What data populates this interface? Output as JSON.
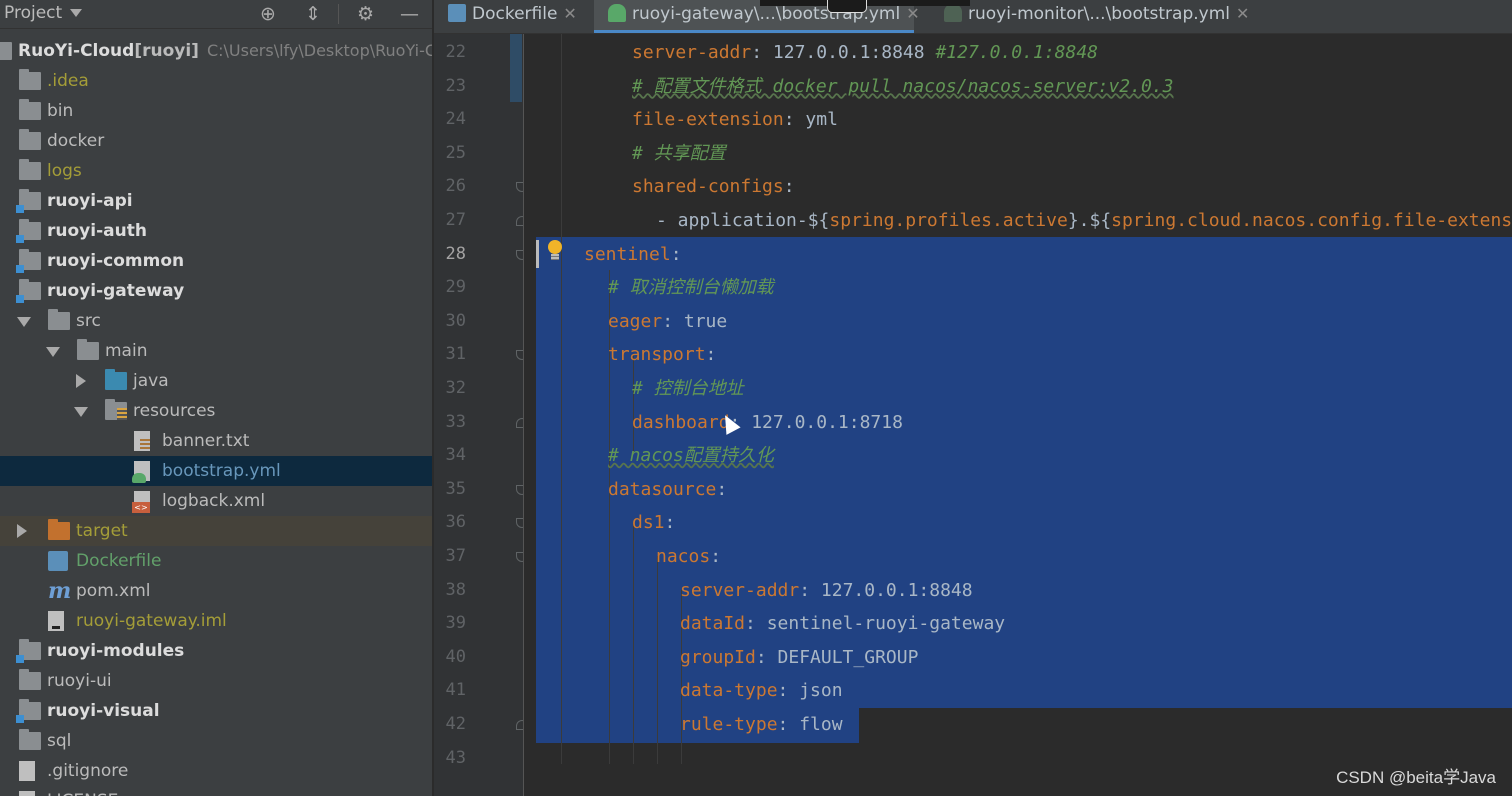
{
  "project_panel": {
    "title": "Project",
    "tree": [
      {
        "label": "RuoYi-Cloud",
        "tag": "[ruoyi]",
        "hint": "C:\\Users\\lfy\\Desktop\\RuoYi-C",
        "style": "bold",
        "icon": "module-icon"
      },
      {
        "label": ".idea",
        "style": "olive",
        "icon": "folder-icon"
      },
      {
        "label": "bin",
        "style": "normal",
        "icon": "folder-icon"
      },
      {
        "label": "docker",
        "style": "normal",
        "icon": "folder-icon"
      },
      {
        "label": "logs",
        "style": "olive",
        "icon": "folder-icon"
      },
      {
        "label": "ruoyi-api",
        "style": "bold",
        "icon": "module-icon"
      },
      {
        "label": "ruoyi-auth",
        "style": "bold",
        "icon": "module-icon"
      },
      {
        "label": "ruoyi-common",
        "style": "bold",
        "icon": "module-icon"
      },
      {
        "label": "ruoyi-gateway",
        "style": "bold",
        "icon": "module-icon"
      },
      {
        "label": "src",
        "style": "normal",
        "icon": "folder-icon"
      },
      {
        "label": "main",
        "style": "normal",
        "icon": "folder-icon"
      },
      {
        "label": "java",
        "style": "normal",
        "icon": "source-folder-icon"
      },
      {
        "label": "resources",
        "style": "normal",
        "icon": "resources-folder-icon"
      },
      {
        "label": "banner.txt",
        "style": "normal",
        "icon": "text-file-icon"
      },
      {
        "label": "bootstrap.yml",
        "style": "blue",
        "icon": "yaml-file-icon",
        "selected": true
      },
      {
        "label": "logback.xml",
        "style": "normal",
        "icon": "xml-file-icon"
      },
      {
        "label": "target",
        "style": "olive",
        "icon": "excluded-folder-icon"
      },
      {
        "label": "Dockerfile",
        "style": "green",
        "icon": "docker-file-icon"
      },
      {
        "label": "pom.xml",
        "style": "normal",
        "icon": "maven-icon"
      },
      {
        "label": "ruoyi-gateway.iml",
        "style": "olive",
        "icon": "iml-file-icon"
      },
      {
        "label": "ruoyi-modules",
        "style": "bold",
        "icon": "module-icon"
      },
      {
        "label": "ruoyi-ui",
        "style": "normal",
        "icon": "folder-icon"
      },
      {
        "label": "ruoyi-visual",
        "style": "bold",
        "icon": "module-icon"
      },
      {
        "label": "sql",
        "style": "normal",
        "icon": "folder-icon"
      },
      {
        "label": ".gitignore",
        "style": "normal",
        "icon": "gitignore-file-icon"
      },
      {
        "label": "LICENSE",
        "style": "normal",
        "icon": "text-file-icon"
      }
    ]
  },
  "tabs": [
    {
      "label": "Dockerfile",
      "icon": "docker-icon",
      "active": false
    },
    {
      "label": "ruoyi-gateway\\...\\bootstrap.yml",
      "icon": "yaml-icon",
      "active": true
    },
    {
      "label": "ruoyi-monitor\\...\\bootstrap.yml",
      "icon": "yaml-icon",
      "active": false
    }
  ],
  "editor": {
    "current_line": 28,
    "lines": [
      {
        "n": 22,
        "parts": [
          [
            "k",
            "server-addr"
          ],
          [
            "v",
            ": 127.0.0.1:8848 "
          ],
          [
            "c",
            "#127.0.0.1:8848"
          ]
        ]
      },
      {
        "n": 23,
        "parts": [
          [
            "c",
            "# 配置文件格式 docker pull nacos/nacos-server:v2.0.3"
          ]
        ]
      },
      {
        "n": 24,
        "parts": [
          [
            "k",
            "file-extension"
          ],
          [
            "v",
            ": yml"
          ]
        ]
      },
      {
        "n": 25,
        "parts": [
          [
            "c",
            "# 共享配置"
          ]
        ]
      },
      {
        "n": 26,
        "parts": [
          [
            "k",
            "shared-configs"
          ],
          [
            "v",
            ":"
          ]
        ]
      },
      {
        "n": 27,
        "parts": [
          [
            "v",
            "- application-${"
          ],
          [
            "k",
            "spring.profiles.active"
          ],
          [
            "v",
            "}.${"
          ],
          [
            "k",
            "spring.cloud.nacos.config.file-extension"
          ],
          [
            "v",
            "}"
          ]
        ]
      },
      {
        "n": 28,
        "parts": [
          [
            "k",
            "sentinel"
          ],
          [
            "v",
            ":"
          ]
        ]
      },
      {
        "n": 29,
        "parts": [
          [
            "c",
            "# 取消控制台懒加载"
          ]
        ]
      },
      {
        "n": 30,
        "parts": [
          [
            "k",
            "eager"
          ],
          [
            "v",
            ": true"
          ]
        ]
      },
      {
        "n": 31,
        "parts": [
          [
            "k",
            "transport"
          ],
          [
            "v",
            ":"
          ]
        ]
      },
      {
        "n": 32,
        "parts": [
          [
            "c",
            "# 控制台地址"
          ]
        ]
      },
      {
        "n": 33,
        "parts": [
          [
            "k",
            "dashboard"
          ],
          [
            "v",
            ": 127.0.0.1:8718"
          ]
        ]
      },
      {
        "n": 34,
        "parts": [
          [
            "c",
            "# nacos配置持久化"
          ]
        ]
      },
      {
        "n": 35,
        "parts": [
          [
            "k",
            "datasource"
          ],
          [
            "v",
            ":"
          ]
        ]
      },
      {
        "n": 36,
        "parts": [
          [
            "k",
            "ds1"
          ],
          [
            "v",
            ":"
          ]
        ]
      },
      {
        "n": 37,
        "parts": [
          [
            "k",
            "nacos"
          ],
          [
            "v",
            ":"
          ]
        ]
      },
      {
        "n": 38,
        "parts": [
          [
            "k",
            "server-addr"
          ],
          [
            "v",
            ": 127.0.0.1:8848"
          ]
        ]
      },
      {
        "n": 39,
        "parts": [
          [
            "k",
            "dataId"
          ],
          [
            "v",
            ": sentinel-ruoyi-gateway"
          ]
        ]
      },
      {
        "n": 40,
        "parts": [
          [
            "k",
            "groupId"
          ],
          [
            "v",
            ": DEFAULT_GROUP"
          ]
        ]
      },
      {
        "n": 41,
        "parts": [
          [
            "k",
            "data-type"
          ],
          [
            "v",
            ": json"
          ]
        ]
      },
      {
        "n": 42,
        "parts": [
          [
            "k",
            "rule-type"
          ],
          [
            "v",
            ": flow"
          ]
        ]
      },
      {
        "n": 43,
        "parts": []
      }
    ]
  },
  "watermark": "CSDN @beita学Java",
  "colors": {
    "panel_bg": "#3c3f41",
    "editor_bg": "#2b2b2b",
    "selection": "#214283",
    "keyword": "#cc7832",
    "comment": "#629755",
    "text": "#a9b7c6",
    "tab_underline": "#4a88c7"
  }
}
